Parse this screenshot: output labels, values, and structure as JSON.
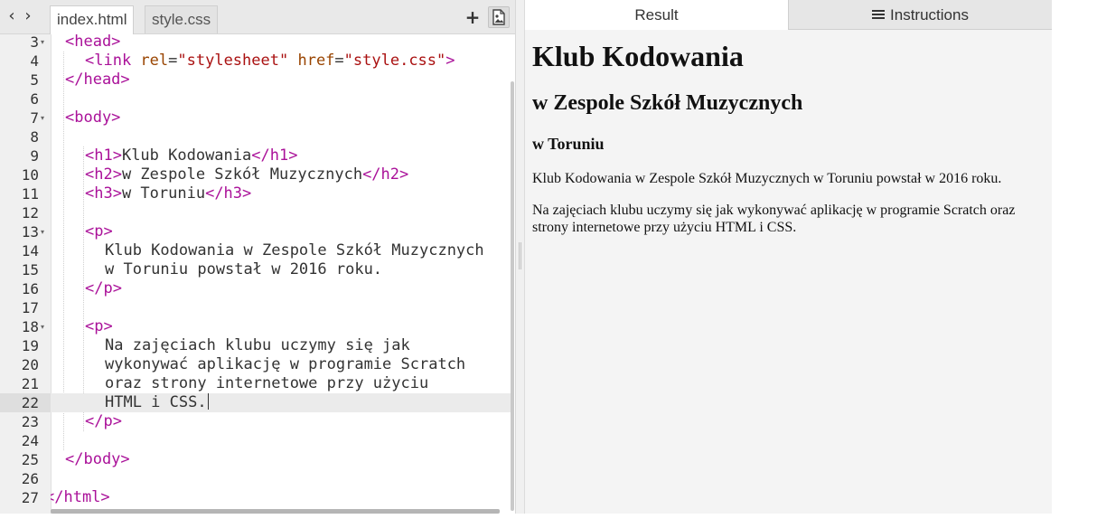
{
  "editor": {
    "tabs": [
      {
        "label": "index.html",
        "active": true
      },
      {
        "label": "style.css",
        "active": false
      }
    ],
    "current_line": 22,
    "lines": [
      {
        "n": "3",
        "fold": true,
        "indent": 1,
        "parts": [
          {
            "t": "<head>",
            "c": "tag"
          }
        ]
      },
      {
        "n": "4",
        "fold": false,
        "indent": 2,
        "parts": [
          {
            "t": "<link ",
            "c": "tag"
          },
          {
            "t": "rel",
            "c": "attr"
          },
          {
            "t": "=",
            "c": ""
          },
          {
            "t": "\"stylesheet\"",
            "c": "str"
          },
          {
            "t": " ",
            "c": ""
          },
          {
            "t": "href",
            "c": "attr"
          },
          {
            "t": "=",
            "c": ""
          },
          {
            "t": "\"style.css\"",
            "c": "str"
          },
          {
            "t": ">",
            "c": "tag"
          }
        ]
      },
      {
        "n": "5",
        "fold": false,
        "indent": 1,
        "parts": [
          {
            "t": "</head>",
            "c": "tag"
          }
        ]
      },
      {
        "n": "6",
        "fold": false,
        "indent": 0,
        "parts": []
      },
      {
        "n": "7",
        "fold": true,
        "indent": 1,
        "parts": [
          {
            "t": "<body>",
            "c": "tag"
          }
        ]
      },
      {
        "n": "8",
        "fold": false,
        "indent": 0,
        "parts": []
      },
      {
        "n": "9",
        "fold": false,
        "indent": 2,
        "parts": [
          {
            "t": "<h1>",
            "c": "tag"
          },
          {
            "t": "Klub Kodowania",
            "c": ""
          },
          {
            "t": "</h1>",
            "c": "tag"
          }
        ]
      },
      {
        "n": "10",
        "fold": false,
        "indent": 2,
        "parts": [
          {
            "t": "<h2>",
            "c": "tag"
          },
          {
            "t": "w Zespole Szkół Muzycznych",
            "c": ""
          },
          {
            "t": "</h2>",
            "c": "tag"
          }
        ]
      },
      {
        "n": "11",
        "fold": false,
        "indent": 2,
        "parts": [
          {
            "t": "<h3>",
            "c": "tag"
          },
          {
            "t": "w Toruniu",
            "c": ""
          },
          {
            "t": "</h3>",
            "c": "tag"
          }
        ]
      },
      {
        "n": "12",
        "fold": false,
        "indent": 0,
        "parts": []
      },
      {
        "n": "13",
        "fold": true,
        "indent": 2,
        "parts": [
          {
            "t": "<p>",
            "c": "tag"
          }
        ]
      },
      {
        "n": "14",
        "fold": false,
        "indent": 3,
        "parts": [
          {
            "t": "Klub Kodowania w Zespole Szkół Muzycznych",
            "c": ""
          }
        ]
      },
      {
        "n": "15",
        "fold": false,
        "indent": 3,
        "parts": [
          {
            "t": "w Toruniu powstał w 2016 roku.",
            "c": ""
          }
        ]
      },
      {
        "n": "16",
        "fold": false,
        "indent": 2,
        "parts": [
          {
            "t": "</p>",
            "c": "tag"
          }
        ]
      },
      {
        "n": "17",
        "fold": false,
        "indent": 0,
        "parts": []
      },
      {
        "n": "18",
        "fold": true,
        "indent": 2,
        "parts": [
          {
            "t": "<p>",
            "c": "tag"
          }
        ]
      },
      {
        "n": "19",
        "fold": false,
        "indent": 3,
        "parts": [
          {
            "t": "Na zajęciach klubu uczymy się jak",
            "c": ""
          }
        ]
      },
      {
        "n": "20",
        "fold": false,
        "indent": 3,
        "parts": [
          {
            "t": "wykonywać aplikację w programie Scratch",
            "c": ""
          }
        ]
      },
      {
        "n": "21",
        "fold": false,
        "indent": 3,
        "parts": [
          {
            "t": "oraz strony internetowe przy użyciu",
            "c": ""
          }
        ]
      },
      {
        "n": "22",
        "fold": false,
        "indent": 3,
        "parts": [
          {
            "t": "HTML i CSS.",
            "c": ""
          }
        ]
      },
      {
        "n": "23",
        "fold": false,
        "indent": 2,
        "parts": [
          {
            "t": "</p>",
            "c": "tag"
          }
        ]
      },
      {
        "n": "24",
        "fold": false,
        "indent": 0,
        "parts": []
      },
      {
        "n": "25",
        "fold": false,
        "indent": 1,
        "parts": [
          {
            "t": "</body>",
            "c": "tag"
          }
        ]
      },
      {
        "n": "26",
        "fold": false,
        "indent": 0,
        "parts": []
      },
      {
        "n": "27",
        "fold": false,
        "indent": 0,
        "parts": [
          {
            "t": "</html>",
            "c": "tag"
          }
        ]
      }
    ],
    "toolbar": {
      "add_icon": "plus-icon",
      "image_icon": "image-icon"
    },
    "nav": {
      "back_icon": "chevron-left-icon",
      "forward_icon": "chevron-right-icon"
    }
  },
  "preview": {
    "tabs": {
      "result": "Result",
      "instructions": "Instructions"
    },
    "instructions_icon": "list-icon",
    "content": {
      "h1": "Klub Kodowania",
      "h2": "w Zespole Szkół Muzycznych",
      "h3": "w Toruniu",
      "p1": "Klub Kodowania w Zespole Szkół Muzycznych w Toruniu powstał w 2016 roku.",
      "p2": "Na zajęciach klubu uczymy się jak wykonywać aplikację w programie Scratch oraz strony internetowe przy użyciu HTML i CSS."
    }
  },
  "colors": {
    "tag": "#aa1199",
    "attr": "#994400",
    "string": "#aa1111",
    "text": "#333333"
  }
}
